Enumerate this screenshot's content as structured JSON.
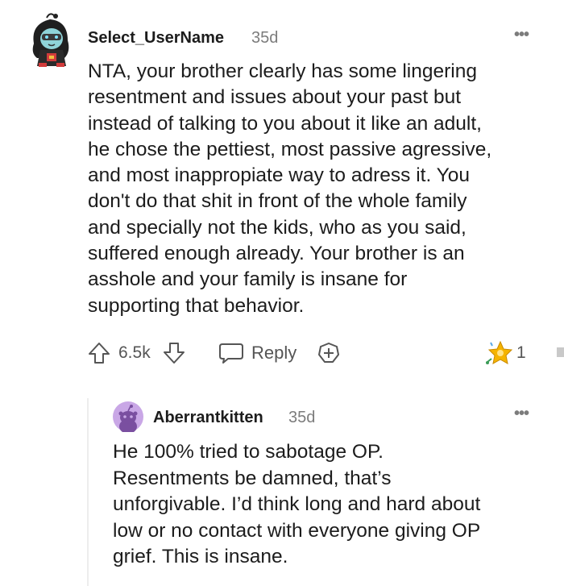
{
  "comment": {
    "username": "Select_UserName",
    "time": "35d",
    "more_label": "•••",
    "body_lines": [
      "NTA, your brother clearly has some lingering",
      "resentment and issues about your past but",
      "instead of talking to you about it like an adult,",
      "he chose the pettiest, most passive agressive,",
      "and most inappropiate way to adress it. You",
      "don't do that shit in front of the whole family",
      "and specially not the kids, who as you said,",
      "suffered enough already. Your brother is an",
      "asshole and your family is insane for",
      "supporting that behavior."
    ],
    "votes": "6.5k",
    "reply_label": "Reply",
    "award_count": "1",
    "icons": {
      "upvote": "arrow-up-icon",
      "downvote": "arrow-down-icon",
      "reply": "speech-bubble-icon",
      "award": "plus-circle-icon",
      "award_received": "star-award-icon"
    }
  },
  "reply": {
    "username": "Aberrantkitten",
    "time": "35d",
    "more_label": "•••",
    "body_lines": [
      "He 100% tried to sabotage OP.",
      "Resentments be damned, that’s",
      "unforgivable. I’d think long and hard about",
      "low or no contact with everyone giving OP",
      "grief. This is insane."
    ],
    "avatar_color": "#c9a7e6"
  },
  "colors": {
    "text": "#1c1c1c",
    "muted": "#7c7c7c",
    "icon": "#555555",
    "award_gold": "#f5b400"
  }
}
